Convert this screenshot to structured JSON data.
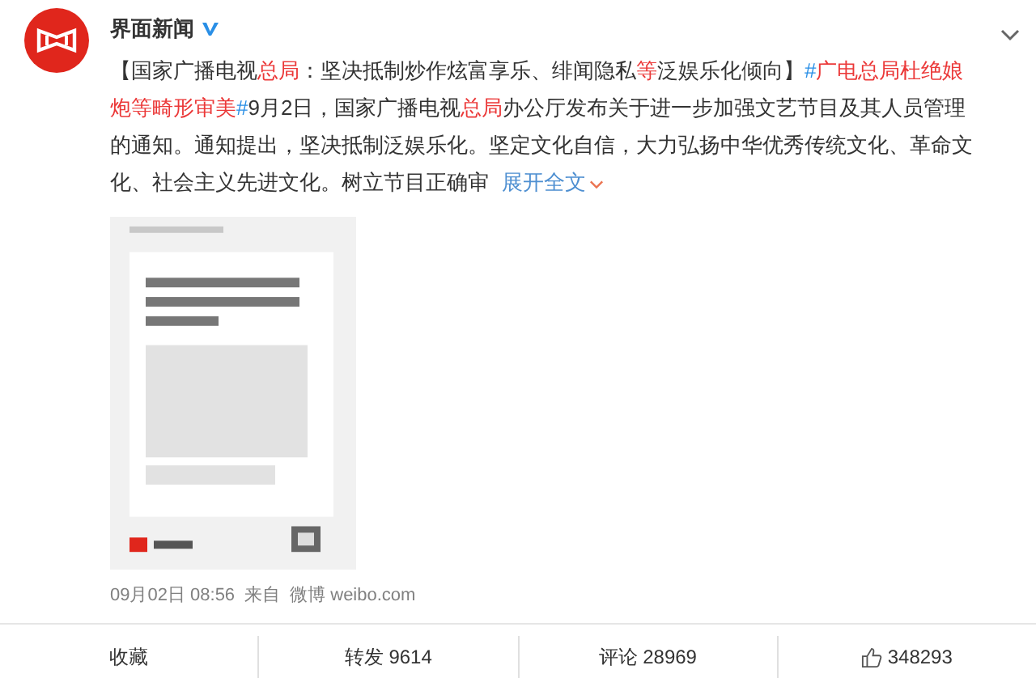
{
  "post": {
    "author": "界面新闻",
    "verified": true,
    "body": [
      {
        "kind": "text",
        "text": "【国家广播电视"
      },
      {
        "kind": "highlight",
        "text": "总局"
      },
      {
        "kind": "text",
        "text": "：坚决抵制炒作炫富享乐、绯闻隐私"
      },
      {
        "kind": "highlight",
        "text": "等"
      },
      {
        "kind": "text",
        "text": "泛娱乐化倾向】"
      },
      {
        "kind": "hash",
        "text": "#"
      },
      {
        "kind": "highlight",
        "text": "广电总局杜绝娘炮等畸形审美"
      },
      {
        "kind": "hash",
        "text": "#"
      },
      {
        "kind": "text",
        "text": "9月2日，国家广播电视"
      },
      {
        "kind": "highlight",
        "text": "总局"
      },
      {
        "kind": "text",
        "text": "办公厅发布关于进一步加强文艺节目及其人员管理的通知。通知提出，坚决抵制泛娱乐化。坚定文化自信，大力弘扬中华优秀传统文化、革命文化、社会主义先进文化。树立节目正确审"
      }
    ],
    "expand_link": "展开全文",
    "timestamp": "09月02日 08:56",
    "source_label": "来自",
    "source": "微博 weibo.com"
  },
  "actions": [
    {
      "kind": "plain",
      "label": "收藏"
    },
    {
      "kind": "plain",
      "label": "转发 9614"
    },
    {
      "kind": "plain",
      "label": "评论 28969"
    },
    {
      "kind": "like",
      "label": "348293"
    }
  ]
}
